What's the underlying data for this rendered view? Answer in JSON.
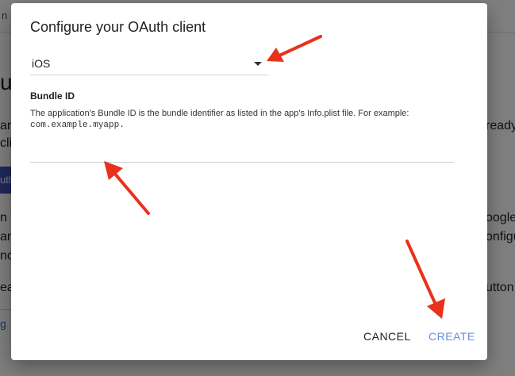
{
  "background": {
    "tab_text": "n :",
    "heading_fragment": "u",
    "fragments": [
      "an",
      "cli",
      "utl",
      "n th",
      "an",
      "nc",
      "ea",
      "g"
    ],
    "right_fragments": [
      "ready",
      "oogle",
      "onfigu",
      "utton"
    ]
  },
  "dialog": {
    "title": "Configure your OAuth client",
    "select": {
      "value": "iOS"
    },
    "bundle": {
      "label": "Bundle ID",
      "help_text": "The application's Bundle ID is the bundle identifier as listed in the app's Info.plist file. For example:",
      "example": "com.example.myapp.",
      "value": ""
    },
    "buttons": {
      "cancel": "CANCEL",
      "create": "CREATE"
    }
  },
  "colors": {
    "arrow": "#e8321c",
    "create_button": "#6b8cde",
    "bg_button": "#3f51b5"
  }
}
